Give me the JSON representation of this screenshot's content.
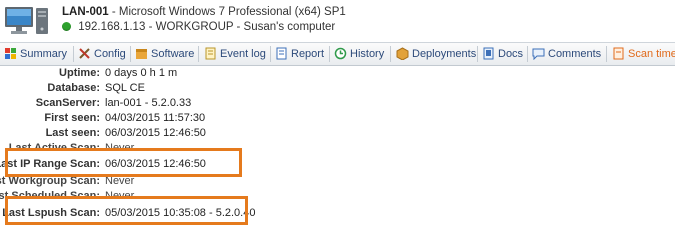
{
  "header": {
    "hostname": "LAN-001",
    "os": "Microsoft Windows 7 Professional (x64) SP1",
    "ip": "192.168.1.13",
    "workgroup_desc": "WORKGROUP - Susan's computer",
    "status_color": "#2ea12e"
  },
  "tabs": [
    {
      "label": "Summary",
      "icon": "summary-icon"
    },
    {
      "label": "Config",
      "icon": "config-icon"
    },
    {
      "label": "Software",
      "icon": "software-icon"
    },
    {
      "label": "Event log",
      "icon": "event-log-icon"
    },
    {
      "label": "Report",
      "icon": "report-icon"
    },
    {
      "label": "History",
      "icon": "history-icon"
    },
    {
      "label": "Deployments",
      "icon": "deployments-icon"
    },
    {
      "label": "Docs",
      "icon": "docs-icon"
    },
    {
      "label": "Comments",
      "icon": "comments-icon"
    },
    {
      "label": "Scan time",
      "icon": "scan-time-icon"
    }
  ],
  "details": [
    {
      "label": "Uptime:",
      "value": "0 days 0 h 1 m"
    },
    {
      "label": "Database:",
      "value": "SQL CE"
    },
    {
      "label": "ScanServer:",
      "value": "lan-001 - 5.2.0.33"
    },
    {
      "label": "First seen:",
      "value": "04/03/2015 11:57:30"
    },
    {
      "label": "Last seen:",
      "value": "06/03/2015 12:46:50"
    },
    {
      "label": "Last Active Scan:",
      "value": "Never"
    },
    {
      "label": "Last IP Range Scan:",
      "value": "06/03/2015 12:46:50"
    },
    {
      "label": "Last Workgroup Scan:",
      "value": "Never"
    },
    {
      "label": "Last Scheduled Scan:",
      "value": "Never"
    },
    {
      "label": "Last Lspush Scan:",
      "value": "05/03/2015 10:35:08 - 5.2.0.40"
    }
  ],
  "highlight_color": "#e57a1d"
}
